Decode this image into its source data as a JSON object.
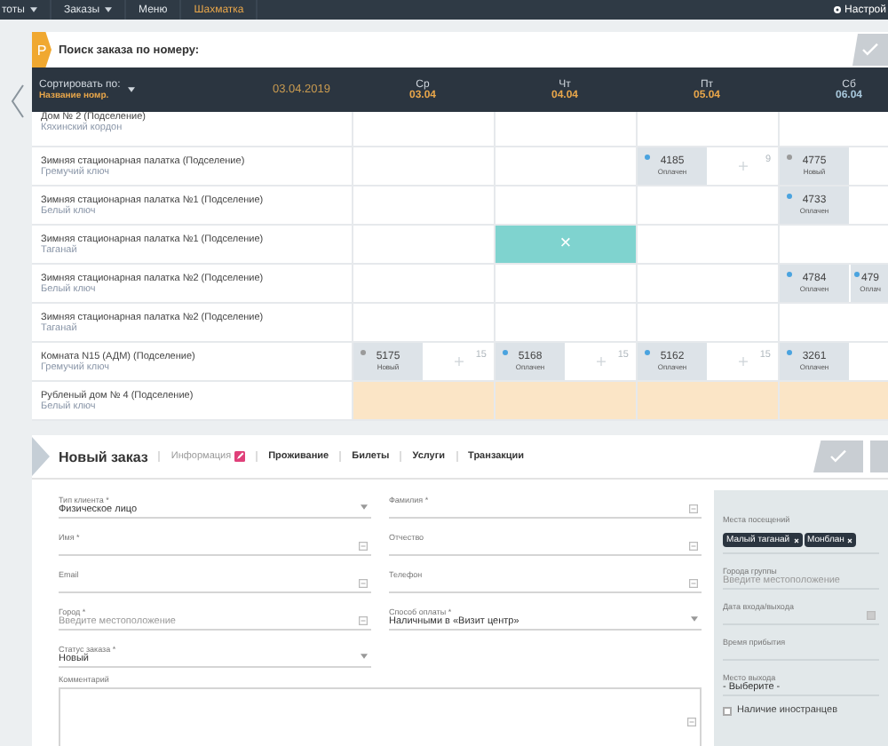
{
  "nav": {
    "items": [
      {
        "label": "тоты",
        "dropdown": true,
        "selected": false
      },
      {
        "label": "Заказы",
        "dropdown": true,
        "selected": false
      },
      {
        "label": "Меню",
        "dropdown": false,
        "selected": false
      },
      {
        "label": "Шахматка",
        "dropdown": false,
        "selected": true
      }
    ],
    "settings": "Настрой"
  },
  "search": {
    "badge": "Р",
    "label": "Поиск заказа по номеру:"
  },
  "schedule": {
    "sort_label": "Сортировать по:",
    "sort_value": "Название номр.",
    "start_date": "03.04.2019",
    "days": [
      {
        "dow": "Ср",
        "date": "03.04",
        "weekend": false
      },
      {
        "dow": "Чт",
        "date": "04.04",
        "weekend": false
      },
      {
        "dow": "Пт",
        "date": "05.04",
        "weekend": false
      },
      {
        "dow": "Сб",
        "date": "06.04",
        "weekend": true
      }
    ],
    "rows": [
      {
        "name": "Дом № 2 (Подселение)",
        "place": "Кяхинский кордон",
        "highlighted": false,
        "cells": [
          {
            "kind": "empty"
          },
          {
            "kind": "empty"
          },
          {
            "kind": "empty"
          },
          {
            "kind": "empty"
          }
        ]
      },
      {
        "name": "Зимняя стационарная палатка (Подселение)",
        "place": "Гремучий ключ",
        "highlighted": false,
        "cells": [
          {
            "kind": "empty"
          },
          {
            "kind": "empty"
          },
          {
            "kind": "booked",
            "bookings": [
              {
                "number": "4185",
                "status": "Оплачен",
                "color": "#4aa3df"
              }
            ],
            "count": "9"
          },
          {
            "kind": "booked",
            "bookings": [
              {
                "number": "4775",
                "status": "Новый",
                "color": "#9a9a9a"
              }
            ]
          }
        ]
      },
      {
        "name": "Зимняя стационарная палатка №1 (Подселение)",
        "place": "Белый ключ",
        "highlighted": false,
        "cells": [
          {
            "kind": "empty"
          },
          {
            "kind": "empty"
          },
          {
            "kind": "empty"
          },
          {
            "kind": "booked",
            "bookings": [
              {
                "number": "4733",
                "status": "Оплачен",
                "color": "#4aa3df"
              }
            ]
          }
        ]
      },
      {
        "name": "Зимняя стационарная палатка №1 (Подселение)",
        "place": "Таганай",
        "highlighted": false,
        "cells": [
          {
            "kind": "empty"
          },
          {
            "kind": "blocked",
            "mark": "×"
          },
          {
            "kind": "empty"
          },
          {
            "kind": "empty"
          }
        ]
      },
      {
        "name": "Зимняя стационарная палатка №2 (Подселение)",
        "place": "Белый ключ",
        "highlighted": false,
        "cells": [
          {
            "kind": "empty"
          },
          {
            "kind": "empty"
          },
          {
            "kind": "empty"
          },
          {
            "kind": "booked",
            "bookings": [
              {
                "number": "4784",
                "status": "Оплачен",
                "color": "#4aa3df"
              },
              {
                "number": "479",
                "status": "Оплач",
                "color": "#4aa3df"
              }
            ]
          }
        ]
      },
      {
        "name": "Зимняя стационарная палатка №2 (Подселение)",
        "place": "Таганай",
        "highlighted": false,
        "cells": [
          {
            "kind": "empty"
          },
          {
            "kind": "empty"
          },
          {
            "kind": "empty"
          },
          {
            "kind": "empty"
          }
        ]
      },
      {
        "name": "Комната N15 (АДМ) (Подселение)",
        "place": "Гремучий ключ",
        "highlighted": false,
        "cells": [
          {
            "kind": "booked",
            "bookings": [
              {
                "number": "5175",
                "status": "Новый",
                "color": "#9a9a9a"
              }
            ],
            "count": "15"
          },
          {
            "kind": "booked",
            "bookings": [
              {
                "number": "5168",
                "status": "Оплачен",
                "color": "#4aa3df"
              }
            ],
            "count": "15"
          },
          {
            "kind": "booked",
            "bookings": [
              {
                "number": "5162",
                "status": "Оплачен",
                "color": "#4aa3df"
              }
            ],
            "count": "15"
          },
          {
            "kind": "booked",
            "bookings": [
              {
                "number": "3261",
                "status": "Оплачен",
                "color": "#4aa3df"
              }
            ]
          }
        ]
      },
      {
        "name": "Рубленый дом № 4 (Подселение)",
        "place": "Белый ключ",
        "highlighted": true,
        "cells": [
          {
            "kind": "empty"
          },
          {
            "kind": "empty"
          },
          {
            "kind": "empty"
          },
          {
            "kind": "empty"
          }
        ]
      }
    ]
  },
  "order": {
    "title": "Новый заказ",
    "tabs": [
      {
        "label": "Информация",
        "selected": true,
        "flagged": true
      },
      {
        "label": "Проживание",
        "selected": false,
        "flagged": false
      },
      {
        "label": "Билеты",
        "selected": false,
        "flagged": false
      },
      {
        "label": "Услуги",
        "selected": false,
        "flagged": false
      },
      {
        "label": "Транзакции",
        "selected": false,
        "flagged": false
      }
    ],
    "left_fields": [
      {
        "kind": "select",
        "label": "Тип клиента *",
        "value": "Физическое лицо"
      },
      {
        "kind": "text",
        "label": "Имя *"
      },
      {
        "kind": "text",
        "label": "Email"
      },
      {
        "kind": "text",
        "label": "Город *",
        "placeholder": "Введите местоположение"
      },
      {
        "kind": "select",
        "label": "Статус заказа *",
        "value": "Новый"
      }
    ],
    "middle_fields": [
      {
        "kind": "text",
        "label": "Фамилия *"
      },
      {
        "kind": "text",
        "label": "Отчество"
      },
      {
        "kind": "text",
        "label": "Телефон"
      },
      {
        "kind": "select",
        "label": "Способ оплаты *",
        "value": "Наличными в «Визит центр»"
      }
    ],
    "comment": {
      "label": "Комментарий"
    },
    "side_fields": [
      {
        "kind": "tags",
        "label": "Места посещений",
        "tags": [
          "Малый таганай",
          "Монблан"
        ]
      },
      {
        "kind": "text",
        "label": "Города группы",
        "placeholder": "Введите местоположение"
      },
      {
        "kind": "date",
        "label": "Дата входа/выхода"
      },
      {
        "kind": "text",
        "label": "Время прибытия"
      },
      {
        "kind": "select",
        "label": "Место выхода",
        "value": "- Выберите -"
      },
      {
        "kind": "checkbox",
        "label": "Наличие иностранцев",
        "checked": false
      }
    ]
  }
}
